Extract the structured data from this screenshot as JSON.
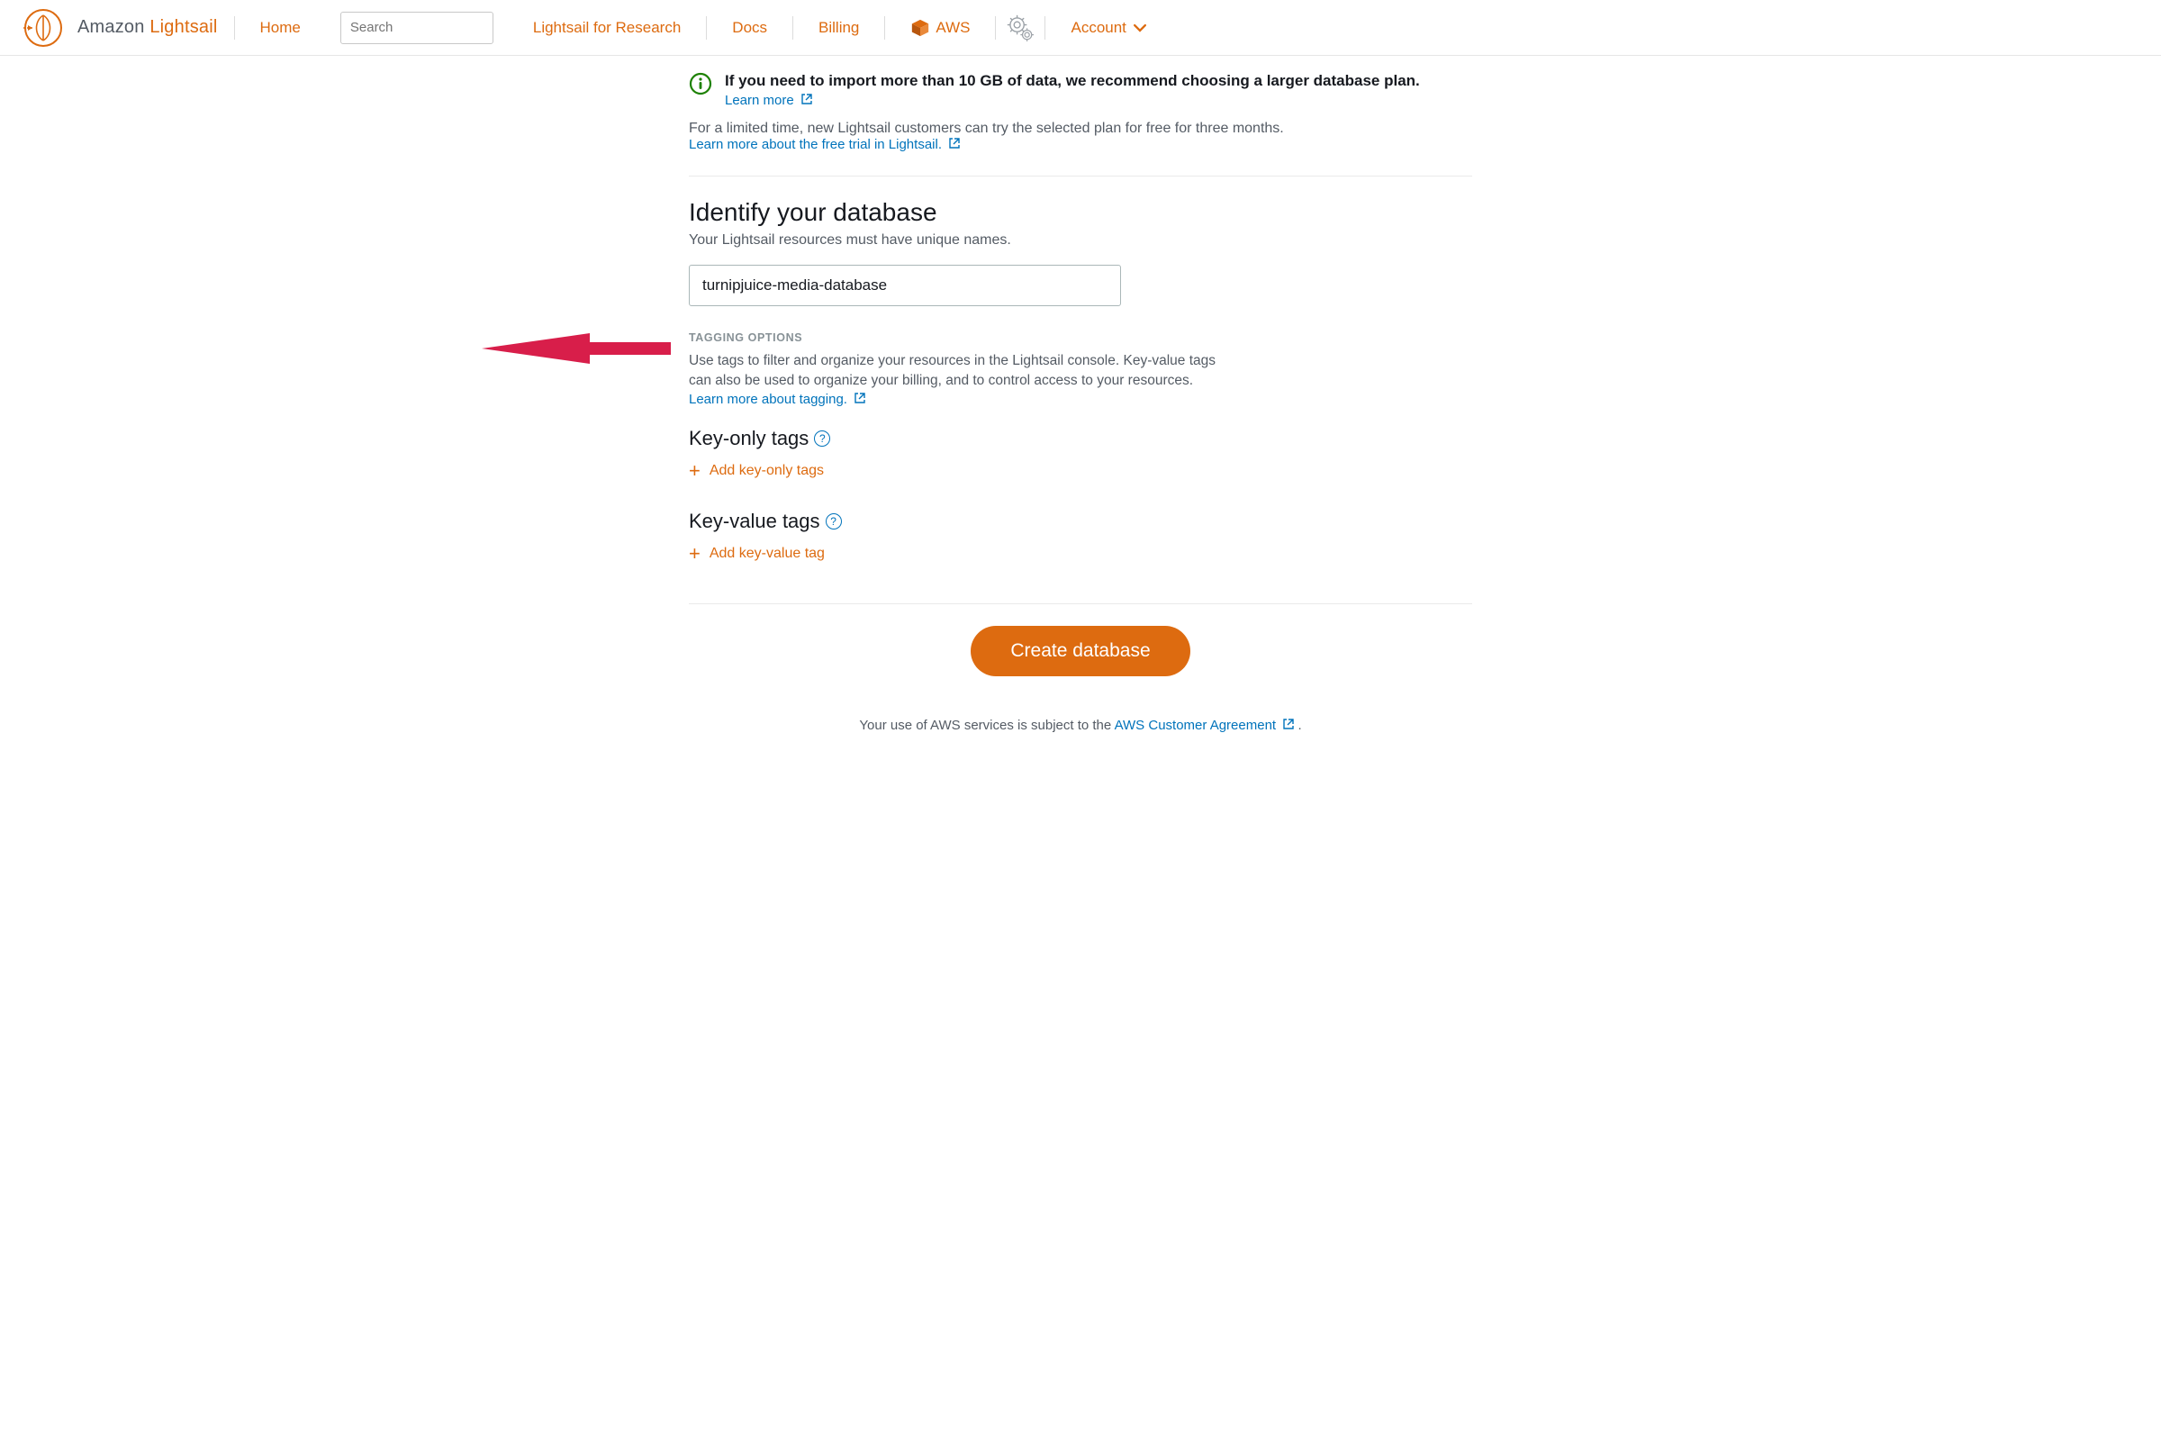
{
  "nav": {
    "brand_prefix": "Amazon ",
    "brand_accent": "Lightsail",
    "home": "Home",
    "search_placeholder": "Search",
    "research": "Lightsail for Research",
    "docs": "Docs",
    "billing": "Billing",
    "aws": "AWS",
    "account": "Account"
  },
  "infoBox": {
    "title": "If you need to import more than 10 GB of data, we recommend choosing a larger database plan.",
    "learn_more": "Learn more"
  },
  "promo": {
    "text": "For a limited time, new Lightsail customers can try the selected plan for free for three months.",
    "link": "Learn more about the free trial in Lightsail."
  },
  "identify": {
    "title": "Identify your database",
    "sub": "Your Lightsail resources must have unique names.",
    "value": "turnipjuice-media-database"
  },
  "tagging": {
    "header": "TAGGING OPTIONS",
    "para": "Use tags to filter and organize your resources in the Lightsail console. Key-value tags can also be used to organize your billing, and to control access to your resources.",
    "learn_link": "Learn more about tagging.",
    "key_only_title": "Key-only tags",
    "add_key_only": "Add key-only tags",
    "key_value_title": "Key-value tags",
    "add_key_value": "Add key-value tag"
  },
  "action": {
    "create": "Create database"
  },
  "footer": {
    "prefix": "Your use of AWS services is subject to the ",
    "agreement": "AWS Customer Agreement",
    "suffix": " ."
  }
}
